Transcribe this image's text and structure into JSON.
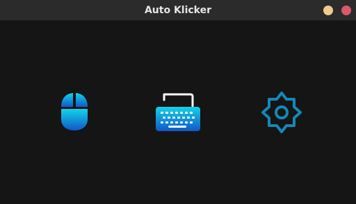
{
  "window": {
    "title": "Auto Klicker",
    "controls": {
      "minimize_color": "#f2c98f",
      "close_color": "#d9596b"
    }
  },
  "main": {
    "tiles": [
      {
        "id": "mouse",
        "icon": "mouse-icon"
      },
      {
        "id": "keyboard",
        "icon": "keyboard-icon"
      },
      {
        "id": "settings",
        "icon": "gear-icon"
      }
    ]
  },
  "colors": {
    "background": "#151515",
    "titlebar": "#2b2b2b",
    "accent_light": "#13d3e8",
    "accent_dark": "#1257c7",
    "gear": "#1488b8"
  }
}
